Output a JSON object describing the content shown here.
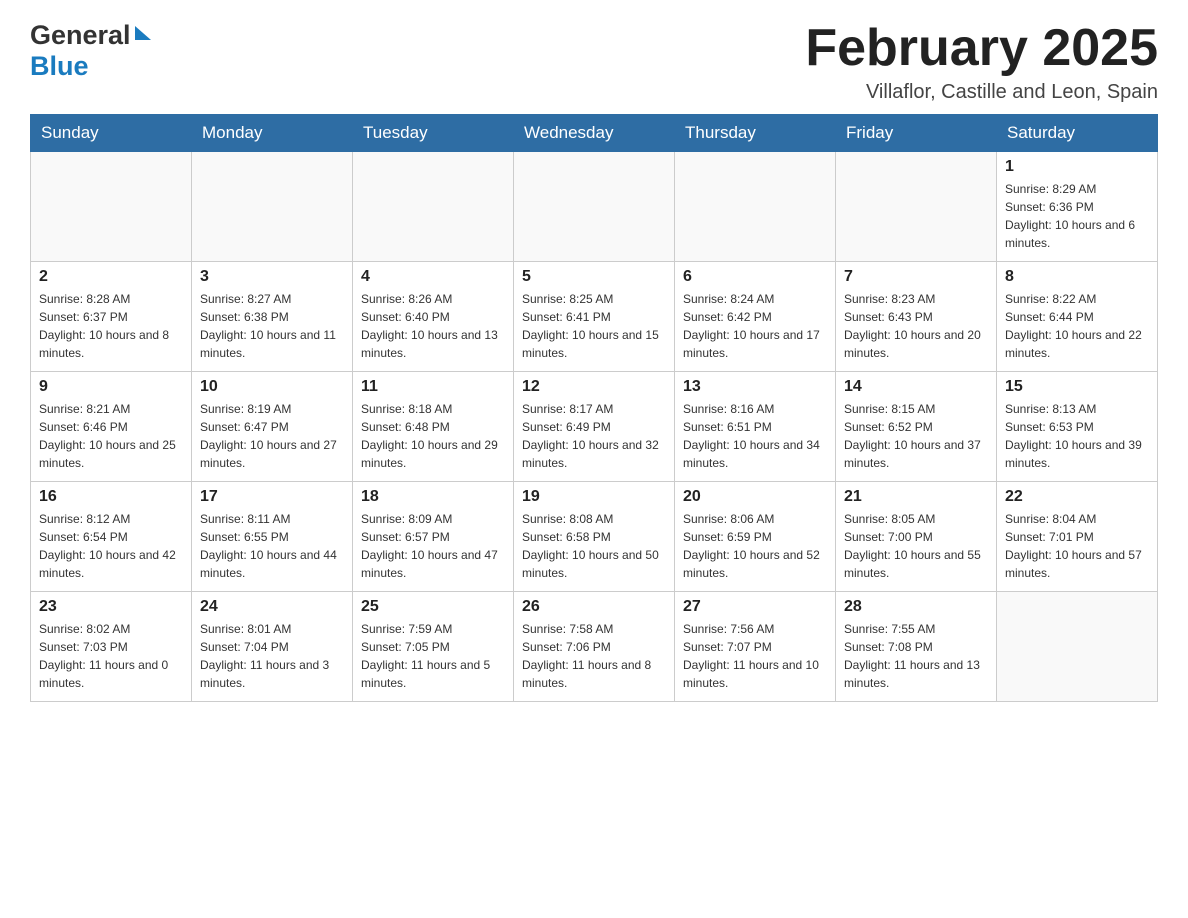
{
  "header": {
    "logo_general": "General",
    "logo_blue": "Blue",
    "month_title": "February 2025",
    "location": "Villaflor, Castille and Leon, Spain"
  },
  "weekdays": [
    "Sunday",
    "Monday",
    "Tuesday",
    "Wednesday",
    "Thursday",
    "Friday",
    "Saturday"
  ],
  "weeks": [
    {
      "days": [
        {
          "number": "",
          "info": ""
        },
        {
          "number": "",
          "info": ""
        },
        {
          "number": "",
          "info": ""
        },
        {
          "number": "",
          "info": ""
        },
        {
          "number": "",
          "info": ""
        },
        {
          "number": "",
          "info": ""
        },
        {
          "number": "1",
          "info": "Sunrise: 8:29 AM\nSunset: 6:36 PM\nDaylight: 10 hours and 6 minutes."
        }
      ]
    },
    {
      "days": [
        {
          "number": "2",
          "info": "Sunrise: 8:28 AM\nSunset: 6:37 PM\nDaylight: 10 hours and 8 minutes."
        },
        {
          "number": "3",
          "info": "Sunrise: 8:27 AM\nSunset: 6:38 PM\nDaylight: 10 hours and 11 minutes."
        },
        {
          "number": "4",
          "info": "Sunrise: 8:26 AM\nSunset: 6:40 PM\nDaylight: 10 hours and 13 minutes."
        },
        {
          "number": "5",
          "info": "Sunrise: 8:25 AM\nSunset: 6:41 PM\nDaylight: 10 hours and 15 minutes."
        },
        {
          "number": "6",
          "info": "Sunrise: 8:24 AM\nSunset: 6:42 PM\nDaylight: 10 hours and 17 minutes."
        },
        {
          "number": "7",
          "info": "Sunrise: 8:23 AM\nSunset: 6:43 PM\nDaylight: 10 hours and 20 minutes."
        },
        {
          "number": "8",
          "info": "Sunrise: 8:22 AM\nSunset: 6:44 PM\nDaylight: 10 hours and 22 minutes."
        }
      ]
    },
    {
      "days": [
        {
          "number": "9",
          "info": "Sunrise: 8:21 AM\nSunset: 6:46 PM\nDaylight: 10 hours and 25 minutes."
        },
        {
          "number": "10",
          "info": "Sunrise: 8:19 AM\nSunset: 6:47 PM\nDaylight: 10 hours and 27 minutes."
        },
        {
          "number": "11",
          "info": "Sunrise: 8:18 AM\nSunset: 6:48 PM\nDaylight: 10 hours and 29 minutes."
        },
        {
          "number": "12",
          "info": "Sunrise: 8:17 AM\nSunset: 6:49 PM\nDaylight: 10 hours and 32 minutes."
        },
        {
          "number": "13",
          "info": "Sunrise: 8:16 AM\nSunset: 6:51 PM\nDaylight: 10 hours and 34 minutes."
        },
        {
          "number": "14",
          "info": "Sunrise: 8:15 AM\nSunset: 6:52 PM\nDaylight: 10 hours and 37 minutes."
        },
        {
          "number": "15",
          "info": "Sunrise: 8:13 AM\nSunset: 6:53 PM\nDaylight: 10 hours and 39 minutes."
        }
      ]
    },
    {
      "days": [
        {
          "number": "16",
          "info": "Sunrise: 8:12 AM\nSunset: 6:54 PM\nDaylight: 10 hours and 42 minutes."
        },
        {
          "number": "17",
          "info": "Sunrise: 8:11 AM\nSunset: 6:55 PM\nDaylight: 10 hours and 44 minutes."
        },
        {
          "number": "18",
          "info": "Sunrise: 8:09 AM\nSunset: 6:57 PM\nDaylight: 10 hours and 47 minutes."
        },
        {
          "number": "19",
          "info": "Sunrise: 8:08 AM\nSunset: 6:58 PM\nDaylight: 10 hours and 50 minutes."
        },
        {
          "number": "20",
          "info": "Sunrise: 8:06 AM\nSunset: 6:59 PM\nDaylight: 10 hours and 52 minutes."
        },
        {
          "number": "21",
          "info": "Sunrise: 8:05 AM\nSunset: 7:00 PM\nDaylight: 10 hours and 55 minutes."
        },
        {
          "number": "22",
          "info": "Sunrise: 8:04 AM\nSunset: 7:01 PM\nDaylight: 10 hours and 57 minutes."
        }
      ]
    },
    {
      "days": [
        {
          "number": "23",
          "info": "Sunrise: 8:02 AM\nSunset: 7:03 PM\nDaylight: 11 hours and 0 minutes."
        },
        {
          "number": "24",
          "info": "Sunrise: 8:01 AM\nSunset: 7:04 PM\nDaylight: 11 hours and 3 minutes."
        },
        {
          "number": "25",
          "info": "Sunrise: 7:59 AM\nSunset: 7:05 PM\nDaylight: 11 hours and 5 minutes."
        },
        {
          "number": "26",
          "info": "Sunrise: 7:58 AM\nSunset: 7:06 PM\nDaylight: 11 hours and 8 minutes."
        },
        {
          "number": "27",
          "info": "Sunrise: 7:56 AM\nSunset: 7:07 PM\nDaylight: 11 hours and 10 minutes."
        },
        {
          "number": "28",
          "info": "Sunrise: 7:55 AM\nSunset: 7:08 PM\nDaylight: 11 hours and 13 minutes."
        },
        {
          "number": "",
          "info": ""
        }
      ]
    }
  ]
}
